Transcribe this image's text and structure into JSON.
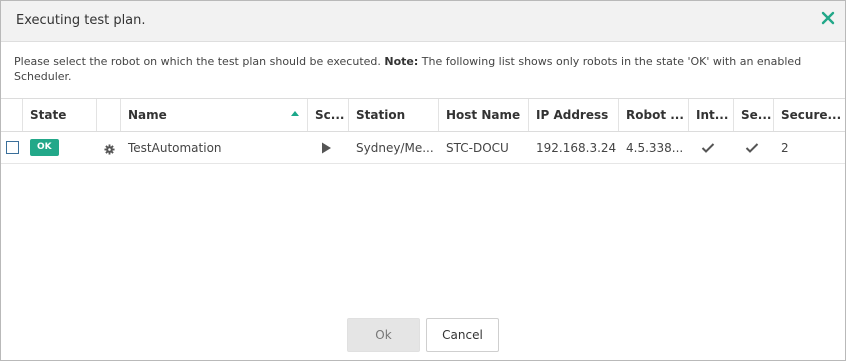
{
  "dialog": {
    "title": "Executing test plan.",
    "close_icon": "close-x-icon",
    "accent_color": "#22a889"
  },
  "message": {
    "text": "Please select the robot on which the test plan should be executed. ",
    "note_label": "Note:",
    "note_text": " The following list shows only robots in the state 'OK' with an enabled Scheduler."
  },
  "table": {
    "columns": [
      "",
      "State",
      "",
      "Name",
      "Sc...",
      "Station",
      "Host Name",
      "IP Address",
      "Robot ...",
      "Int...",
      "Se...",
      "Secure..."
    ],
    "sort_column": "Name",
    "sort_direction": "ascending",
    "rows": [
      {
        "selected": false,
        "state": "OK",
        "type_icon": "gear-icon",
        "name": "TestAutomation",
        "scheduler_icon": "play-icon",
        "station": "Sydney/Me...",
        "host_name": "STC-DOCU",
        "ip_address": "192.168.3.24",
        "robot_version": "4.5.338...",
        "int_icon": "checkmark-icon",
        "se_icon": "checkmark-icon",
        "secure": "2"
      }
    ]
  },
  "buttons": {
    "ok": "Ok",
    "cancel": "Cancel"
  }
}
